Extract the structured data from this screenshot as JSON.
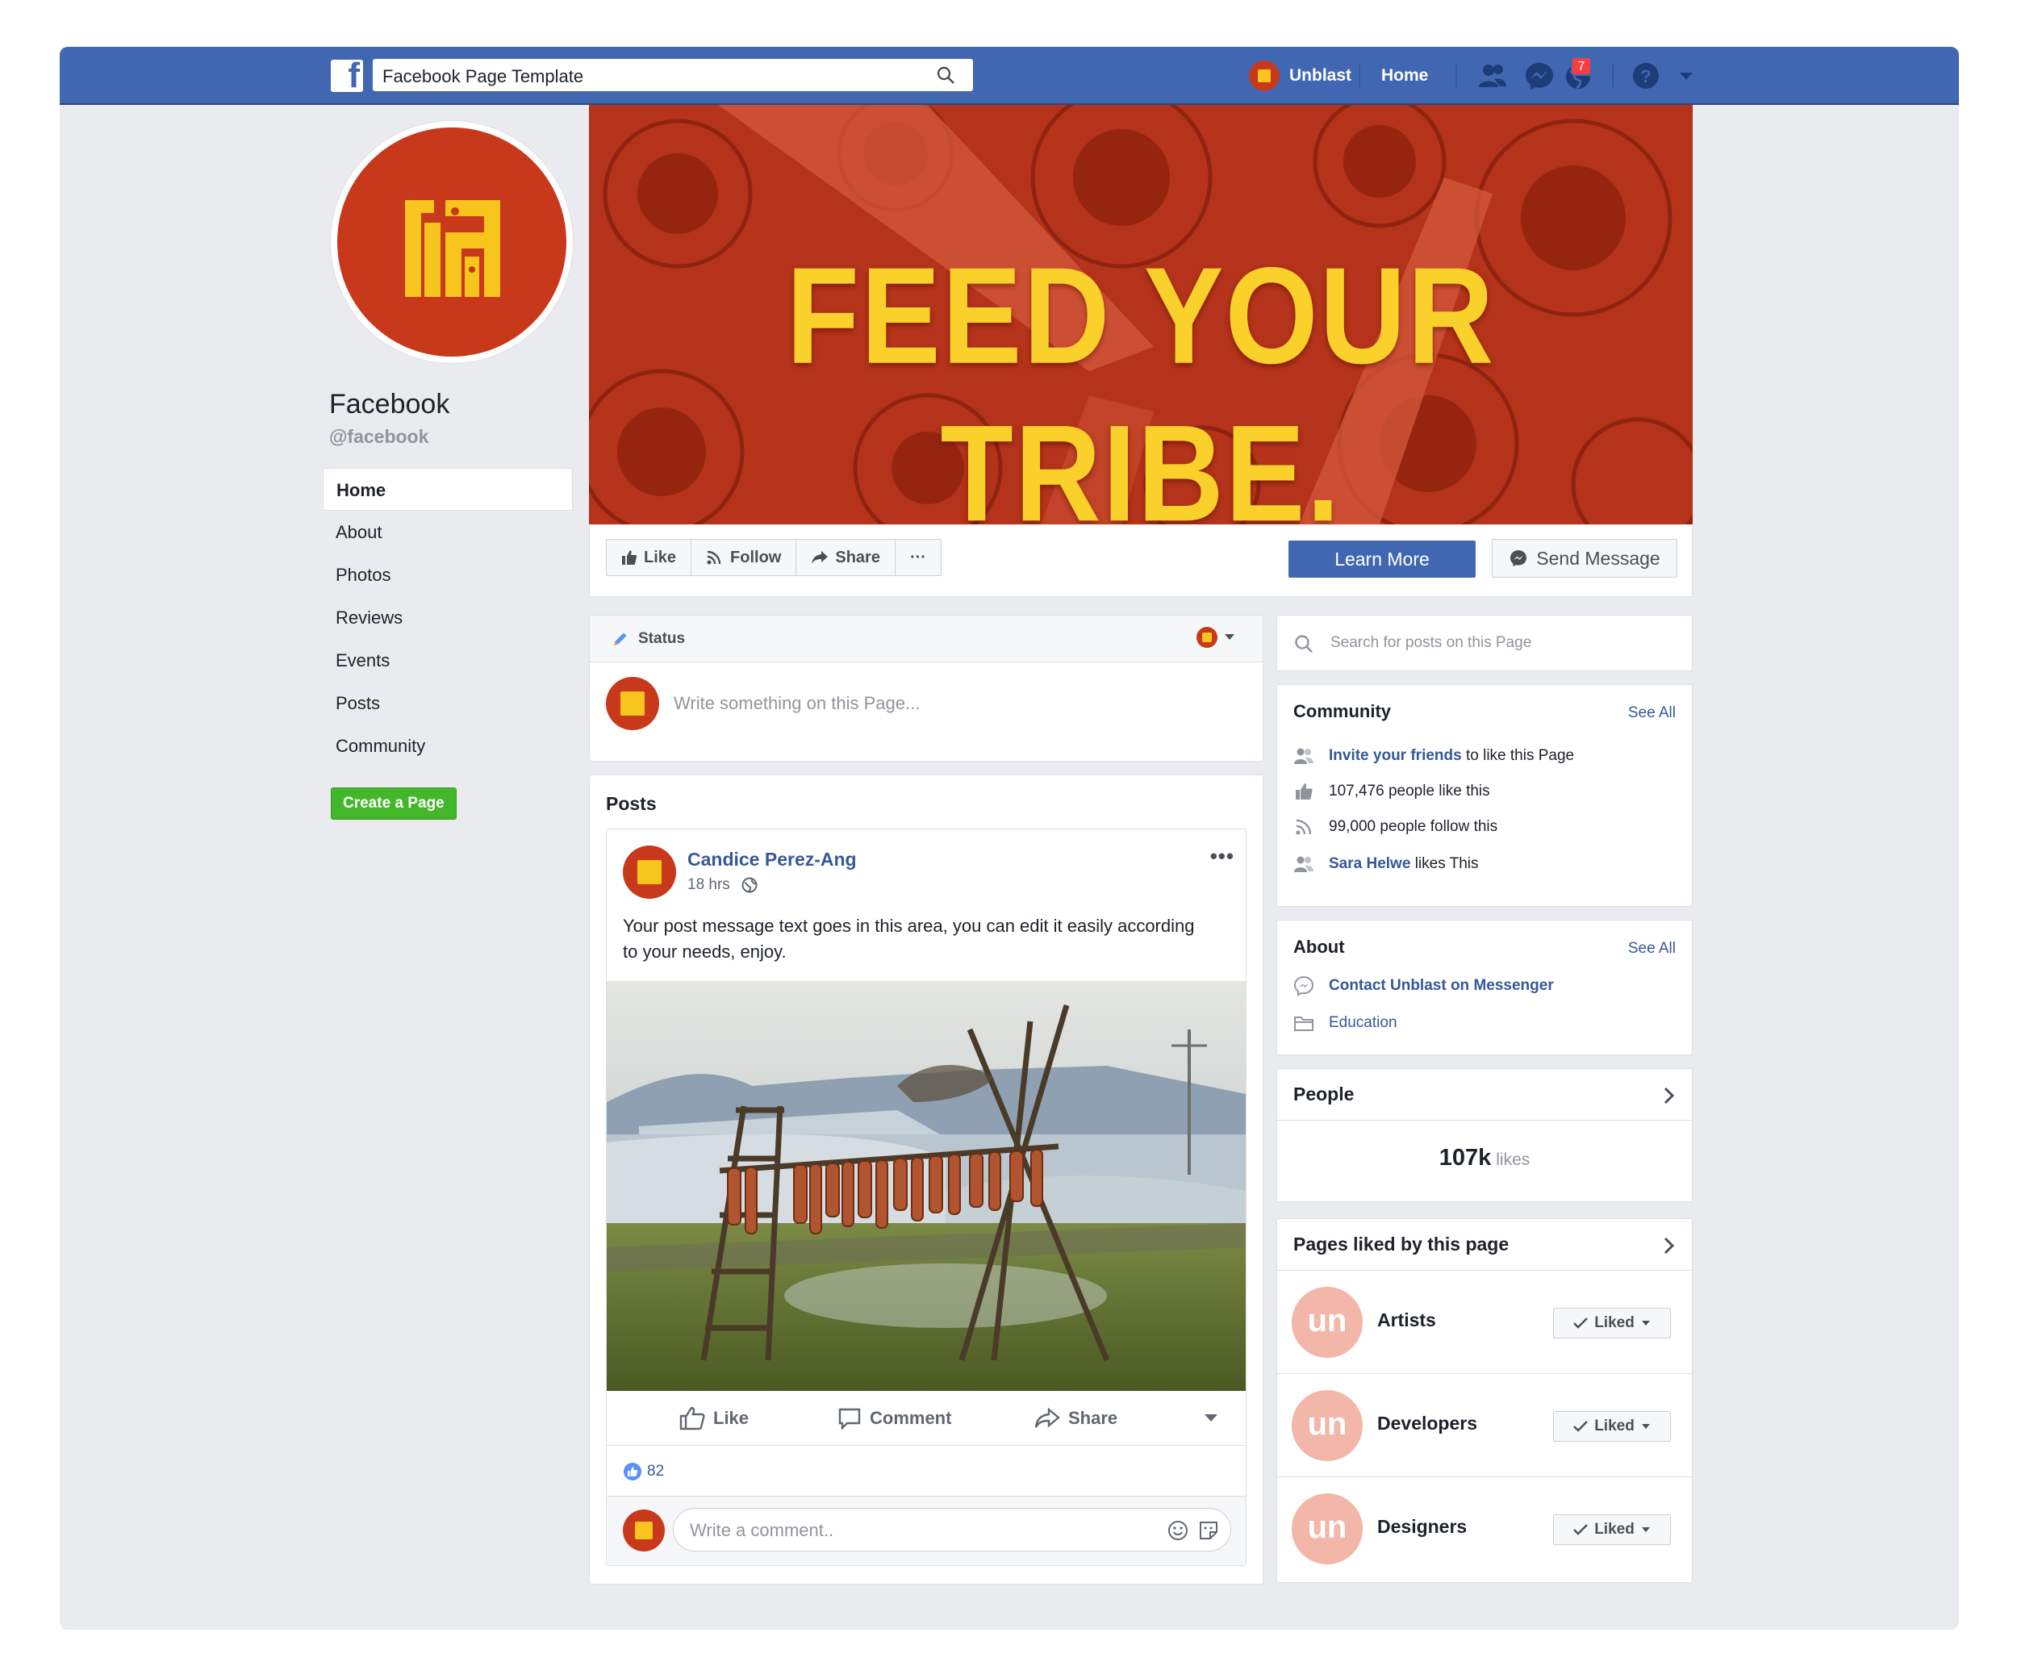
{
  "topbar": {
    "search_value": "Facebook Page Template",
    "brand_name": "Unblast",
    "home_link": "Home",
    "notification_count": "7"
  },
  "page": {
    "name": "Facebook",
    "handle": "@facebook"
  },
  "left_nav": {
    "items": [
      {
        "label": "Home",
        "active": true
      },
      {
        "label": "About"
      },
      {
        "label": "Photos"
      },
      {
        "label": "Reviews"
      },
      {
        "label": "Events"
      },
      {
        "label": "Posts"
      },
      {
        "label": "Community"
      }
    ],
    "create_page": "Create a Page"
  },
  "cover": {
    "headline": "FEED YOUR TRIBE."
  },
  "actions": {
    "like": "Like",
    "follow": "Follow",
    "share": "Share",
    "more": "···",
    "learn_more": "Learn More",
    "send_message": "Send Message"
  },
  "status": {
    "tab_label": "Status",
    "placeholder": "Write something on this Page..."
  },
  "posts": {
    "section_title": "Posts",
    "post": {
      "author": "Candice Perez-Ang",
      "time": "18 hrs",
      "text": "Your post message text goes in this area, you can edit it easily according to your needs, enjoy.",
      "like": "Like",
      "comment": "Comment",
      "share": "Share",
      "reaction_count": "82",
      "comment_placeholder": "Write a comment.."
    }
  },
  "right": {
    "search_placeholder": "Search for posts on this Page",
    "community": {
      "title": "Community",
      "see_all": "See All",
      "invite_link": "Invite your friends",
      "invite_rest": "to like this Page",
      "likes_text": "107,476 people like this",
      "follow_text": "99,000 people follow this",
      "friend_name": "Sara Helwe",
      "friend_rest": "likes This"
    },
    "about": {
      "title": "About",
      "see_all": "See All",
      "contact": "Contact Unblast on Messenger",
      "category": "Education"
    },
    "people": {
      "title": "People",
      "count": "107k",
      "count_label": "likes"
    },
    "pages_liked": {
      "title": "Pages liked by this page",
      "logo_text": "un",
      "button_label": "Liked",
      "items": [
        {
          "name": "Artists"
        },
        {
          "name": "Developers"
        },
        {
          "name": "Designers"
        }
      ]
    }
  },
  "colors": {
    "brand_blue": "#4267b2",
    "link_blue": "#365899",
    "brand_red": "#c8381b",
    "brand_yellow": "#f7c51d",
    "create_green": "#42b72a"
  }
}
